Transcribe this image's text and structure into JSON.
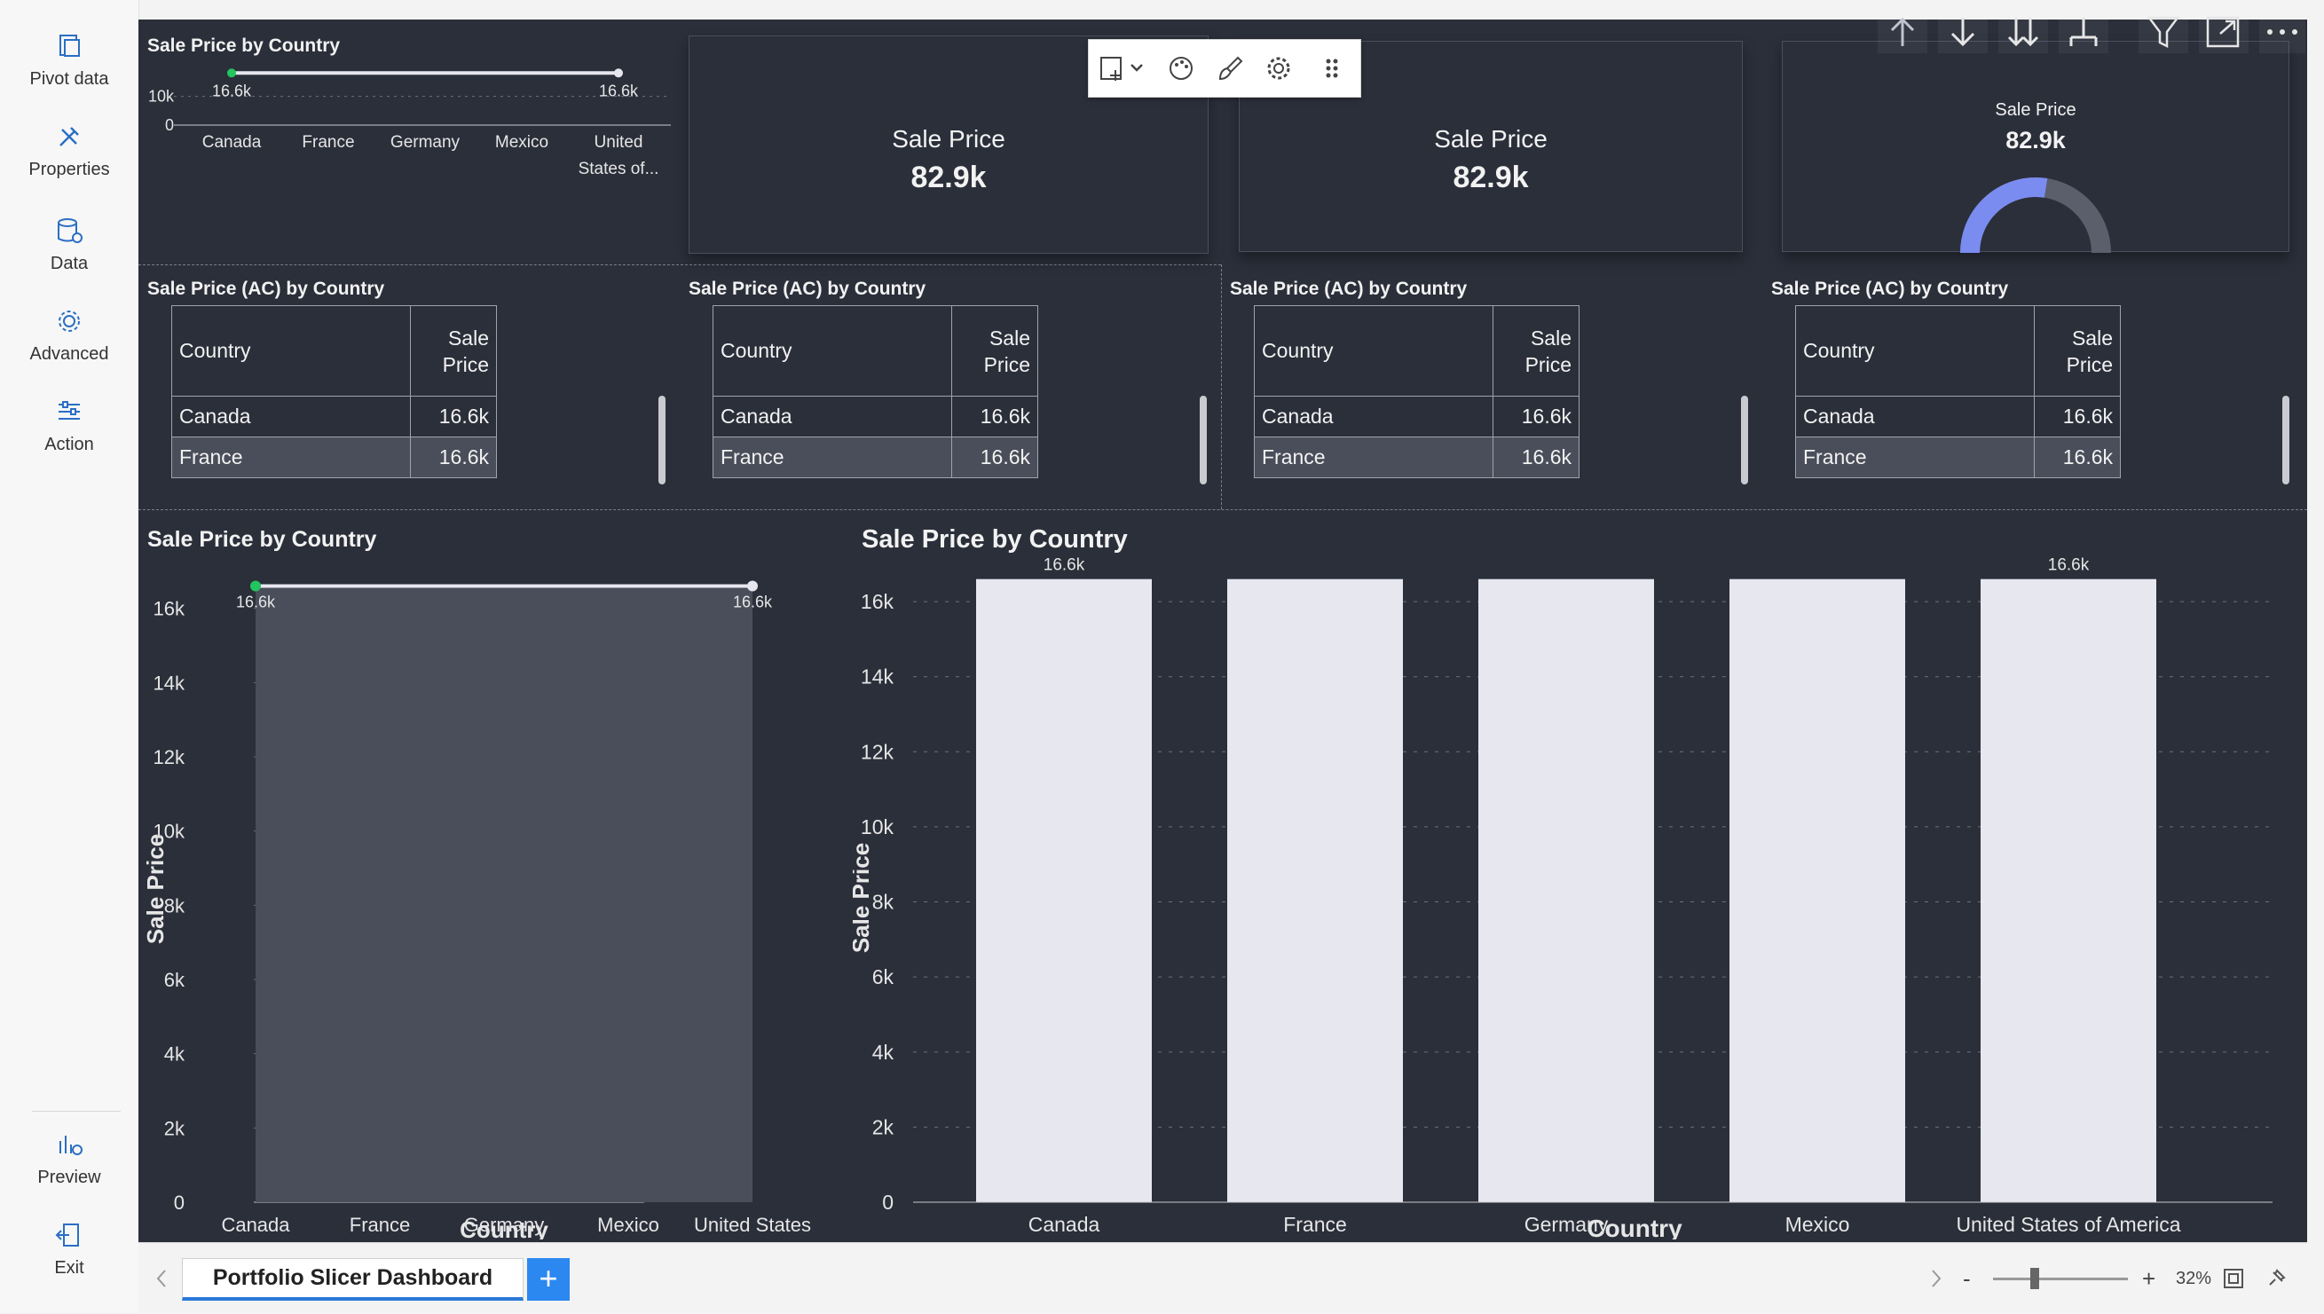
{
  "rail": {
    "items": [
      {
        "label": "Pivot data",
        "icon": "pivot-data-icon"
      },
      {
        "label": "Properties",
        "icon": "properties-icon"
      },
      {
        "label": "Data",
        "icon": "data-icon"
      },
      {
        "label": "Advanced",
        "icon": "advanced-icon"
      },
      {
        "label": "Action",
        "icon": "action-icon"
      }
    ],
    "bottom": [
      {
        "label": "Preview",
        "icon": "preview-icon"
      },
      {
        "label": "Exit",
        "icon": "exit-icon"
      }
    ]
  },
  "visual1": {
    "title": "Sale Price by Country"
  },
  "kpi": [
    {
      "label": "Sale Price",
      "value": "82.9k"
    },
    {
      "label": "Sale Price",
      "value": "82.9k"
    },
    {
      "label": "Sale Price",
      "value": "82.9k"
    }
  ],
  "tables": [
    {
      "title": "Sale Price (AC) by Country"
    },
    {
      "title": "Sale Price (AC) by Country"
    },
    {
      "title": "Sale Price (AC) by Country"
    },
    {
      "title": "Sale Price (AC) by Country"
    }
  ],
  "table_headers": {
    "country": "Country",
    "sale1": "Sale",
    "sale2": "Price"
  },
  "table_rows": [
    {
      "country": "Canada",
      "value": "16.6k"
    },
    {
      "country": "France",
      "value": "16.6k"
    }
  ],
  "visual_area": {
    "title": "Sale Price by Country"
  },
  "visual_bar": {
    "title": "Sale Price by Country"
  },
  "tabs": {
    "page": "Portfolio Slicer Dashboard",
    "add": "+"
  },
  "zoom": {
    "minus": "-",
    "plus": "+",
    "value": "32%"
  },
  "colors": {
    "canvas": "#2b2f3a",
    "bar": "#e6e7ef",
    "area": "#4a4e5a",
    "accent": "#7b8cf0",
    "tab_accent": "#2b79d8"
  },
  "chart_data": [
    {
      "type": "line",
      "title": "Sale Price by Country",
      "categories": [
        "Canada",
        "France",
        "Germany",
        "Mexico",
        "United States of..."
      ],
      "values": [
        16600,
        16600,
        16600,
        16600,
        16600
      ],
      "data_labels": [
        "16.6k",
        "16.6k"
      ],
      "yticks": [
        "10k",
        "0"
      ],
      "ylim": [
        0,
        17000
      ]
    },
    {
      "type": "pie",
      "title": "Sale Price",
      "value": "82.9k",
      "fraction": 0.55
    },
    {
      "type": "area",
      "title": "Sale Price by Country",
      "categories": [
        "Canada",
        "France",
        "Germany",
        "Mexico",
        "United States|of America"
      ],
      "values": [
        16600,
        16600,
        16600,
        16600,
        16600
      ],
      "data_labels": [
        "16.6k",
        "16.6k"
      ],
      "yticks": [
        "16k",
        "14k",
        "12k",
        "10k",
        "8k",
        "6k",
        "4k",
        "2k",
        "0"
      ],
      "ylim": [
        0,
        16900
      ],
      "xlabel": "Country",
      "ylabel": "Sale Price"
    },
    {
      "type": "bar",
      "title": "Sale Price by Country",
      "categories": [
        "Canada",
        "France",
        "Germany",
        "Mexico",
        "United States of America"
      ],
      "values": [
        16600,
        16600,
        16600,
        16600,
        16600
      ],
      "data_labels": [
        "16.6k",
        "",
        "",
        "",
        "16.6k"
      ],
      "yticks": [
        "16k",
        "14k",
        "12k",
        "10k",
        "8k",
        "6k",
        "4k",
        "2k",
        "0"
      ],
      "ylim": [
        0,
        16900
      ],
      "xlabel": "Country",
      "ylabel": "Sale Price"
    }
  ]
}
